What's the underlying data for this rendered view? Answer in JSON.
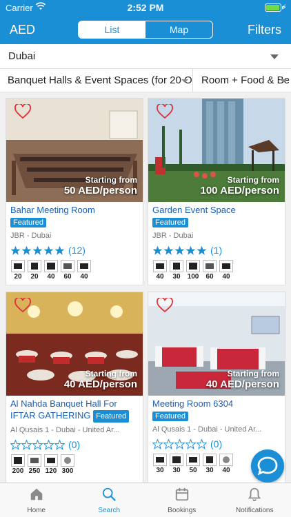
{
  "status": {
    "carrier": "Carrier",
    "time": "2:52 PM",
    "battery_level": 0.85
  },
  "nav": {
    "currency": "AED",
    "tabs": [
      "List",
      "Map"
    ],
    "active_tab": "List",
    "filters": "Filters"
  },
  "city": {
    "value": "Dubai"
  },
  "filters": {
    "venue_type": "Banquet Halls & Event Spaces (for 20 Or",
    "package": "Room + Food & Be"
  },
  "venues": [
    {
      "name": "Bahar Meeting Room",
      "featured": "Featured",
      "location": "JBR - Dubai",
      "rating": 5,
      "reviews": "(12)",
      "price_from": "Starting from",
      "price": "50 AED/person",
      "capacities": [
        "20",
        "20",
        "40",
        "60",
        "40"
      ]
    },
    {
      "name": "Garden Event Space",
      "featured": "Featured",
      "location": "JBR - Dubai",
      "rating": 5,
      "reviews": "(1)",
      "price_from": "Starting from",
      "price": "100 AED/person",
      "capacities": [
        "40",
        "30",
        "100",
        "60",
        "40"
      ]
    },
    {
      "name": "Al Nahda Banquet Hall For IFTAR GATHERING",
      "featured": "Featured",
      "location": "Al Qusais 1 - Dubai - United Ar...",
      "rating": 0,
      "reviews": "(0)",
      "price_from": "Starting from",
      "price": "40 AED/person",
      "capacities": [
        "200",
        "250",
        "120",
        "300"
      ]
    },
    {
      "name": "Meeting Room 6304",
      "featured": "Featured",
      "location": "Al Qusais 1 - Dubai - United Ar...",
      "rating": 0,
      "reviews": "(0)",
      "price_from": "Starting from",
      "price": "40 AED/person",
      "capacities": [
        "30",
        "30",
        "50",
        "30",
        "40"
      ]
    }
  ],
  "tabbar": [
    "Home",
    "Search",
    "Bookings",
    "Notifications"
  ],
  "active_tabbar": "Search",
  "colors": {
    "primary": "#1a8fd6",
    "heart": "#e0323c",
    "star": "#1a8fd6",
    "title": "#1b5fb3"
  }
}
